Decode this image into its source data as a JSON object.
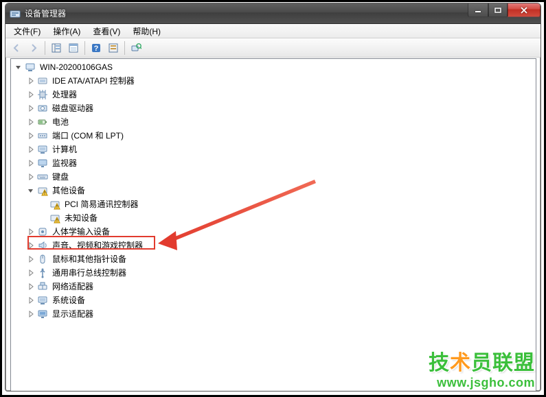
{
  "window": {
    "title": "设备管理器"
  },
  "menubar": {
    "file": "文件(F)",
    "action": "操作(A)",
    "view": "查看(V)",
    "help": "帮助(H)"
  },
  "tree": {
    "root": "WIN-20200106GAS",
    "items": [
      {
        "label": "IDE ATA/ATAPI 控制器"
      },
      {
        "label": "处理器"
      },
      {
        "label": "磁盘驱动器"
      },
      {
        "label": "电池"
      },
      {
        "label": "端口 (COM 和 LPT)"
      },
      {
        "label": "计算机"
      },
      {
        "label": "监视器"
      },
      {
        "label": "键盘"
      },
      {
        "label": "其他设备",
        "expanded": true,
        "children": [
          {
            "label": "PCI 简易通讯控制器"
          },
          {
            "label": "未知设备"
          }
        ]
      },
      {
        "label": "人体学输入设备"
      },
      {
        "label": "声音、视频和游戏控制器",
        "highlighted": true
      },
      {
        "label": "鼠标和其他指针设备"
      },
      {
        "label": "通用串行总线控制器"
      },
      {
        "label": "网络适配器"
      },
      {
        "label": "系统设备"
      },
      {
        "label": "显示适配器"
      }
    ]
  },
  "watermark": {
    "brand_a": "技",
    "brand_b": "术",
    "brand_c": "员联盟",
    "url": "www.jsgho.com"
  }
}
